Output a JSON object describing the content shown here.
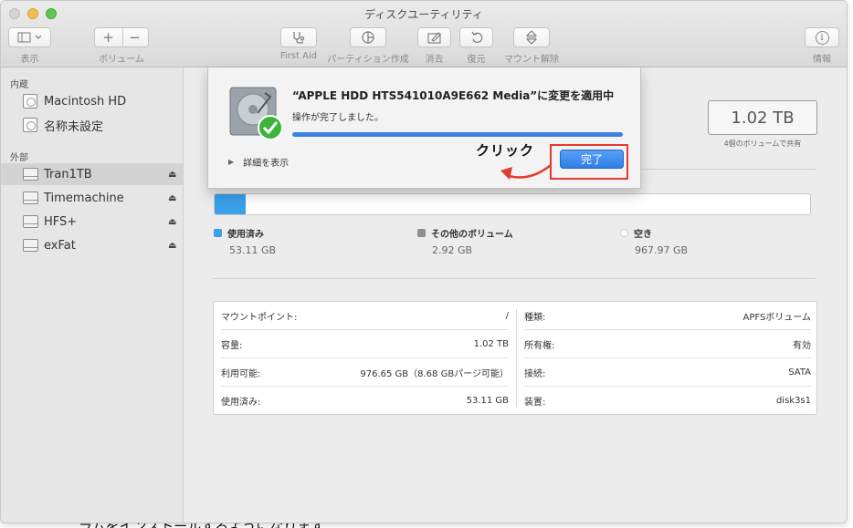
{
  "window": {
    "title": "ディスクユーティリティ"
  },
  "toolbar": {
    "view_label": "表示",
    "volume_label": "ボリューム",
    "firstaid_label": "First Aid",
    "partition_label": "パーティション作成",
    "erase_label": "消去",
    "restore_label": "復元",
    "unmount_label": "マウント解除",
    "info_label": "情報",
    "plus": "+",
    "minus": "−",
    "info_icon": "i"
  },
  "sidebar": {
    "internal_header": "内蔵",
    "external_header": "外部",
    "internal_items": [
      {
        "label": "Macintosh HD"
      },
      {
        "label": "名称未設定"
      }
    ],
    "external_items": [
      {
        "label": "Tran1TB",
        "selected": true
      },
      {
        "label": "Timemachine"
      },
      {
        "label": "HFS+"
      },
      {
        "label": "exFat"
      }
    ],
    "eject_glyph": "⏏"
  },
  "main": {
    "capacity": "1.02 TB",
    "shared_note": "4個のボリュームで共有",
    "usage": {
      "used_fraction": 0.052,
      "legend": [
        {
          "label": "使用済み",
          "value": "53.11 GB",
          "color": "#3aa0ea"
        },
        {
          "label": "その他のボリューム",
          "value": "2.92 GB",
          "color": "#8e8e8e"
        },
        {
          "label": "空き",
          "value": "967.97 GB",
          "color": "#ffffff"
        }
      ]
    },
    "info_left": [
      {
        "key": "マウントポイント:",
        "value": "/"
      },
      {
        "key": "容量:",
        "value": "1.02 TB"
      },
      {
        "key": "利用可能:",
        "value": "976.65 GB（8.68 GBパージ可能）"
      },
      {
        "key": "使用済み:",
        "value": "53.11 GB"
      }
    ],
    "info_right": [
      {
        "key": "種類:",
        "value": "APFSボリューム"
      },
      {
        "key": "所有権:",
        "value": "有効"
      },
      {
        "key": "接続:",
        "value": "SATA"
      },
      {
        "key": "装置:",
        "value": "disk3s1"
      }
    ]
  },
  "sheet": {
    "title": "“APPLE HDD HTS541010A9E662 Media”に変更を適用中",
    "subtitle": "操作が完了しました。",
    "progress": 1.0,
    "details_label": "詳細を表示",
    "done_label": "完了"
  },
  "annotation": {
    "text": "クリック",
    "color": "#e23b2e"
  },
  "background_text": "ラムをインストールするようになります"
}
